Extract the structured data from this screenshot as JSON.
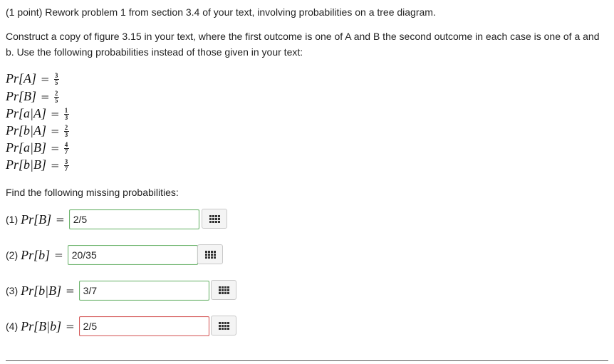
{
  "header": "(1 point) Rework problem 1 from section 3.4 of your text, involving probabilities on a tree diagram.",
  "instructions": {
    "line1": "Construct a copy of figure 3.15 in your text, where the first outcome is one of A and B the second outcome in each case is one of a and",
    "line2": "b. Use the following probabilities instead of those given in your text:"
  },
  "given": [
    {
      "label": "Pr[A]",
      "num": "3",
      "den": "5"
    },
    {
      "label": "Pr[B]",
      "num": "2",
      "den": "5"
    },
    {
      "label": "Pr[a|A]",
      "num": "1",
      "den": "3"
    },
    {
      "label": "Pr[b|A]",
      "num": "2",
      "den": "3"
    },
    {
      "label": "Pr[a|B]",
      "num": "4",
      "den": "7"
    },
    {
      "label": "Pr[b|B]",
      "num": "3",
      "den": "7"
    }
  ],
  "find_text": "Find the following missing probabilities:",
  "questions": [
    {
      "num": "(1)",
      "label": "Pr[B]",
      "value": "2/5",
      "status": "correct"
    },
    {
      "num": "(2)",
      "label": "Pr[b]",
      "value": "20/35",
      "status": "correct"
    },
    {
      "num": "(3)",
      "label": "Pr[b|B]",
      "value": "3/7",
      "status": "correct"
    },
    {
      "num": "(4)",
      "label": "Pr[B|b]",
      "value": "2/5",
      "status": "incorrect"
    }
  ],
  "equals_sign": "=",
  "icons": {
    "keypad": "keypad-icon"
  },
  "colors": {
    "correct_border": "#6fb56f",
    "incorrect_border": "#d55c5c"
  }
}
